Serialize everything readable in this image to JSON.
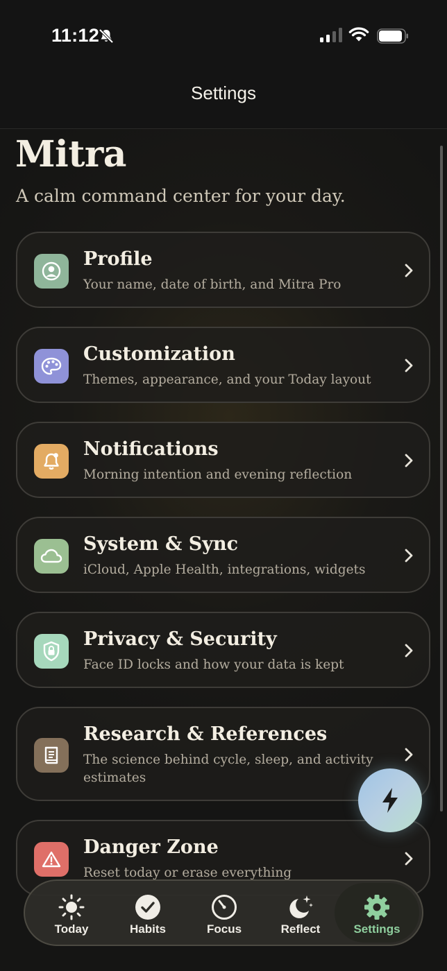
{
  "status_bar": {
    "time": "11:12"
  },
  "nav": {
    "title": "Settings"
  },
  "header": {
    "app_name": "Mitra",
    "tagline": "A calm command center for your day."
  },
  "cards": [
    {
      "title": "Profile",
      "subtitle": "Your name, date of birth, and Mitra Pro",
      "icon": "person-circle-icon",
      "color": "#8fb59a"
    },
    {
      "title": "Customization",
      "subtitle": "Themes, appearance, and your Today layout",
      "icon": "palette-icon",
      "color": "#8f92d8"
    },
    {
      "title": "Notifications",
      "subtitle": "Morning intention and evening reflection",
      "icon": "bell-badge-icon",
      "color": "#e3ab63"
    },
    {
      "title": "System & Sync",
      "subtitle": "iCloud, Apple Health, integrations, widgets",
      "icon": "cloud-icon",
      "color": "#9bbf92"
    },
    {
      "title": "Privacy & Security",
      "subtitle": "Face ID locks and how your data is kept",
      "icon": "lock-shield-icon",
      "color": "#a6d8bc"
    },
    {
      "title": "Research & References",
      "subtitle": "The science behind cycle, sleep, and activity estimates",
      "icon": "book-icon",
      "color": "#84705a"
    },
    {
      "title": "Danger Zone",
      "subtitle": "Reset today or erase everything",
      "icon": "warning-icon",
      "color": "#df6f68"
    }
  ],
  "fab": {
    "icon": "bolt-icon"
  },
  "tabs": [
    {
      "label": "Today",
      "icon": "sun-icon",
      "active": false
    },
    {
      "label": "Habits",
      "icon": "checkmark-circle-icon",
      "active": false
    },
    {
      "label": "Focus",
      "icon": "timer-icon",
      "active": false
    },
    {
      "label": "Reflect",
      "icon": "moon-stars-icon",
      "active": false
    },
    {
      "label": "Settings",
      "icon": "gear-icon",
      "active": true
    }
  ],
  "colors": {
    "background": "#1a1916",
    "accent": "#8fcf9e",
    "text": "#f3eee2"
  }
}
